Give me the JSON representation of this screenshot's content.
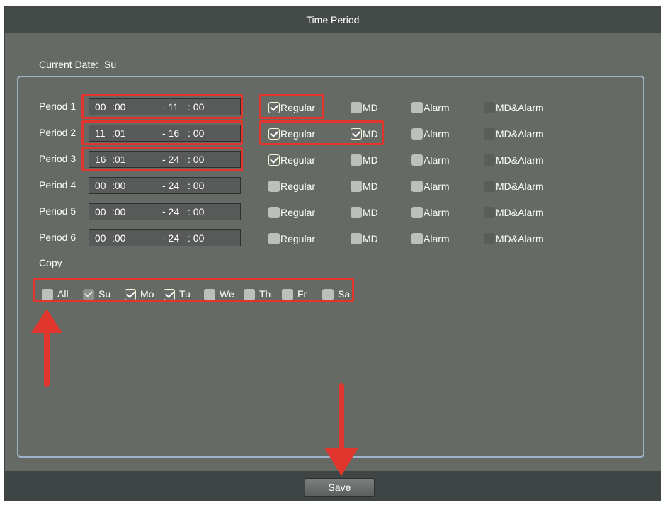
{
  "window": {
    "title": "Time Period"
  },
  "current_date": {
    "label": "Current Date:",
    "value": "Su"
  },
  "columns": [
    "Regular",
    "MD",
    "Alarm",
    "MD&Alarm"
  ],
  "periods": [
    {
      "label": "Period 1",
      "start_h": "00",
      "start_m": ":00",
      "end_h": "- 11",
      "end_m": ": 00",
      "regular": true,
      "md": false,
      "alarm": false,
      "md_alarm": false
    },
    {
      "label": "Period 2",
      "start_h": "11",
      "start_m": ":01",
      "end_h": "- 16",
      "end_m": ": 00",
      "regular": true,
      "md": true,
      "alarm": false,
      "md_alarm": false
    },
    {
      "label": "Period 3",
      "start_h": "16",
      "start_m": ":01",
      "end_h": "- 24",
      "end_m": ": 00",
      "regular": true,
      "md": false,
      "alarm": false,
      "md_alarm": false
    },
    {
      "label": "Period 4",
      "start_h": "00",
      "start_m": ":00",
      "end_h": "- 24",
      "end_m": ": 00",
      "regular": false,
      "md": false,
      "alarm": false,
      "md_alarm": false
    },
    {
      "label": "Period 5",
      "start_h": "00",
      "start_m": ":00",
      "end_h": "- 24",
      "end_m": ": 00",
      "regular": false,
      "md": false,
      "alarm": false,
      "md_alarm": false
    },
    {
      "label": "Period 6",
      "start_h": "00",
      "start_m": ":00",
      "end_h": "- 24",
      "end_m": ": 00",
      "regular": false,
      "md": false,
      "alarm": false,
      "md_alarm": false
    }
  ],
  "copy": {
    "label": "Copy",
    "days": [
      {
        "label": "All",
        "state": "unchecked"
      },
      {
        "label": "Su",
        "state": "current"
      },
      {
        "label": "Mo",
        "state": "checked"
      },
      {
        "label": "Tu",
        "state": "checked"
      },
      {
        "label": "We",
        "state": "unchecked"
      },
      {
        "label": "Th",
        "state": "unchecked"
      },
      {
        "label": "Fr",
        "state": "unchecked"
      },
      {
        "label": "Sa",
        "state": "unchecked"
      }
    ]
  },
  "footer": {
    "save_label": "Save"
  },
  "colors": {
    "highlight": "#e0352c",
    "annotation_arrow": "#e0352c",
    "panel_border": "#9fb2cc",
    "titlebar": "#434a48"
  }
}
